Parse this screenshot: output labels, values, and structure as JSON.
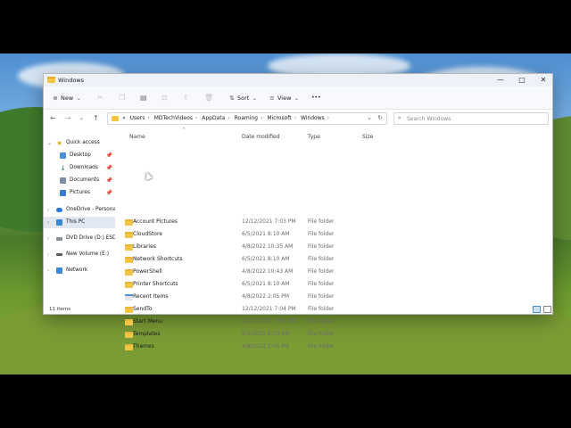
{
  "window": {
    "title": "Windows",
    "minimize_glyph": "—",
    "maximize_glyph": "□",
    "close_glyph": "✕"
  },
  "toolbar": {
    "new_label": "New",
    "sort_label": "Sort",
    "view_label": "View",
    "more_glyph": "•••"
  },
  "address": {
    "overflow": "«",
    "crumbs": [
      "Users",
      "MDTechVideos",
      "AppData",
      "Roaming",
      "Microsoft",
      "Windows"
    ],
    "separator": "›"
  },
  "search": {
    "placeholder": "Search Windows"
  },
  "sidebar": {
    "items": [
      {
        "label": "Quick access",
        "icon": "star-icon"
      },
      {
        "label": "Desktop",
        "icon": "desktop-icon"
      },
      {
        "label": "Downloads",
        "icon": "download-icon"
      },
      {
        "label": "Documents",
        "icon": "documents-icon"
      },
      {
        "label": "Pictures",
        "icon": "pictures-icon"
      },
      {
        "label": "OneDrive - Personal",
        "icon": "cloud-icon"
      },
      {
        "label": "This PC",
        "icon": "computer-icon"
      },
      {
        "label": "DVD Drive (D:) ESD-I",
        "icon": "dvd-icon"
      },
      {
        "label": "New Volume (E:)",
        "icon": "drive-icon"
      },
      {
        "label": "Network",
        "icon": "network-icon"
      }
    ]
  },
  "columns": {
    "name": "Name",
    "date": "Date modified",
    "type": "Type",
    "size": "Size"
  },
  "files": [
    {
      "name": "Account Pictures",
      "date": "12/12/2021 7:03 PM",
      "type": "File folder"
    },
    {
      "name": "CloudStore",
      "date": "6/5/2021 8:10 AM",
      "type": "File folder"
    },
    {
      "name": "Libraries",
      "date": "4/8/2022 10:35 AM",
      "type": "File folder"
    },
    {
      "name": "Network Shortcuts",
      "date": "6/5/2021 8:10 AM",
      "type": "File folder"
    },
    {
      "name": "PowerShell",
      "date": "4/8/2022 10:43 AM",
      "type": "File folder"
    },
    {
      "name": "Printer Shortcuts",
      "date": "6/5/2021 8:10 AM",
      "type": "File folder"
    },
    {
      "name": "Recent Items",
      "date": "4/8/2022 2:05 PM",
      "type": "File folder"
    },
    {
      "name": "SendTo",
      "date": "12/12/2021 7:04 PM",
      "type": "File folder"
    },
    {
      "name": "Start Menu",
      "date": "12/12/2021 7:03 PM",
      "type": "File folder"
    },
    {
      "name": "Templates",
      "date": "6/5/2021 8:10 AM",
      "type": "File folder"
    },
    {
      "name": "Themes",
      "date": "4/8/2022 2:05 PM",
      "type": "File folder"
    }
  ],
  "status": {
    "count": "11 items"
  },
  "colors": {
    "folder": "#f3c545",
    "selection": "#e1e8f2",
    "accent": "#4c8fd6"
  }
}
